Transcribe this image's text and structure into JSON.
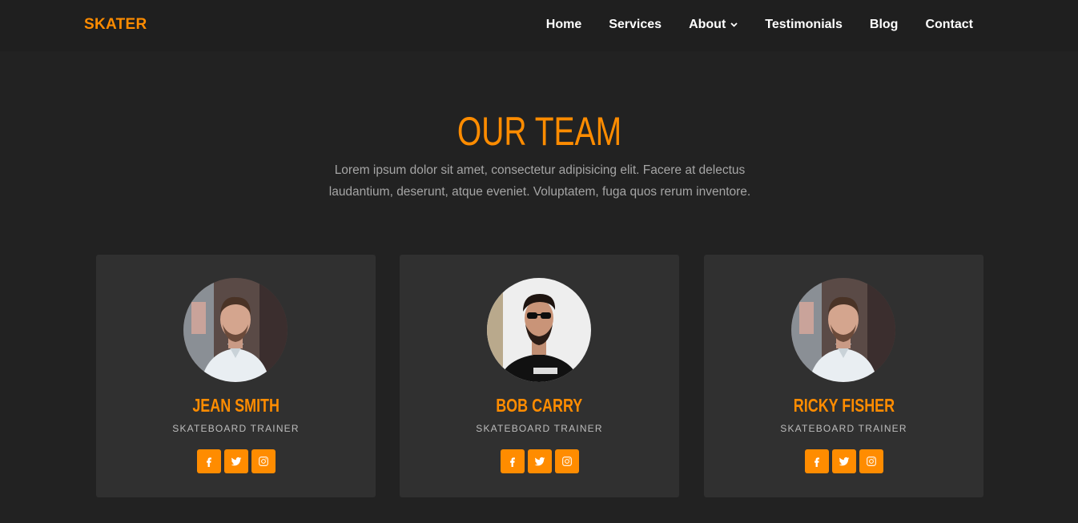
{
  "colors": {
    "accent": "#ff8c00",
    "background": "#222222",
    "card": "#303030",
    "nav": "#1f1f1f"
  },
  "navbar": {
    "brand": "SKATER",
    "links": [
      {
        "label": "Home"
      },
      {
        "label": "Services"
      },
      {
        "label": "About",
        "icon": "chevron-down-icon"
      },
      {
        "label": "Testimonials"
      },
      {
        "label": "Blog"
      },
      {
        "label": "Contact"
      }
    ]
  },
  "team": {
    "title": "OUR TEAM",
    "description_line1": "Lorem ipsum dolor sit amet, consectetur adipisicing elit. Facere at delectus",
    "description_line2": "laudantium, deserunt, atque eveniet. Voluptatem, fuga quos rerum inventore.",
    "members": [
      {
        "name": "JEAN SMITH",
        "role": "SKATEBOARD TRAINER",
        "socials": [
          "facebook-icon",
          "twitter-icon",
          "instagram-icon"
        ]
      },
      {
        "name": "BOB CARRY",
        "role": "SKATEBOARD TRAINER",
        "socials": [
          "facebook-icon",
          "twitter-icon",
          "instagram-icon"
        ]
      },
      {
        "name": "RICKY FISHER",
        "role": "SKATEBOARD TRAINER",
        "socials": [
          "facebook-icon",
          "twitter-icon",
          "instagram-icon"
        ]
      }
    ]
  }
}
